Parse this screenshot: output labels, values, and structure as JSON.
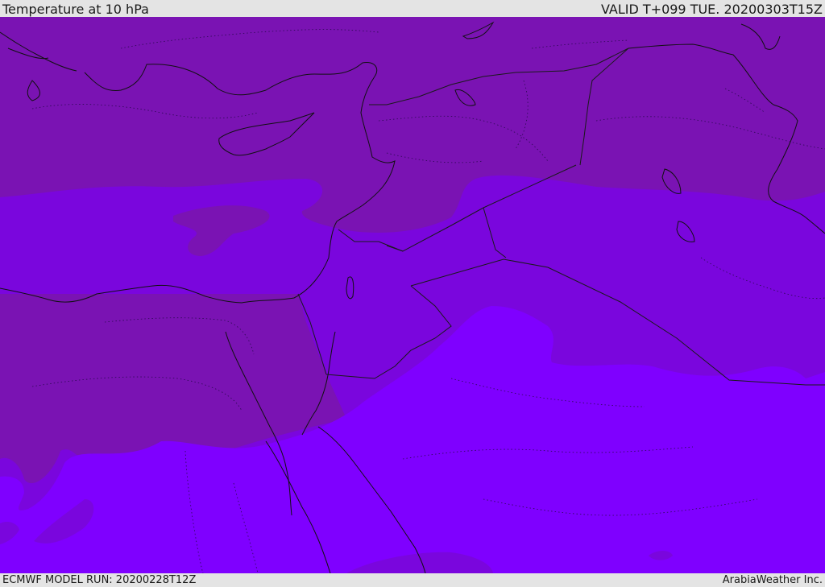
{
  "header": {
    "title": "Temperature at 10 hPa",
    "valid_time": "VALID T+099 TUE. 20200303T15Z"
  },
  "footer": {
    "model_run": "ECMWF MODEL RUN: 20200228T12Z",
    "credit": "ArabiaWeather Inc."
  },
  "colors": {
    "band_dark": "#7a13b3",
    "band_mid": "#7a06dd",
    "band_light": "#7f00ff",
    "coast": "#111111",
    "border": "#1a1a1a"
  }
}
